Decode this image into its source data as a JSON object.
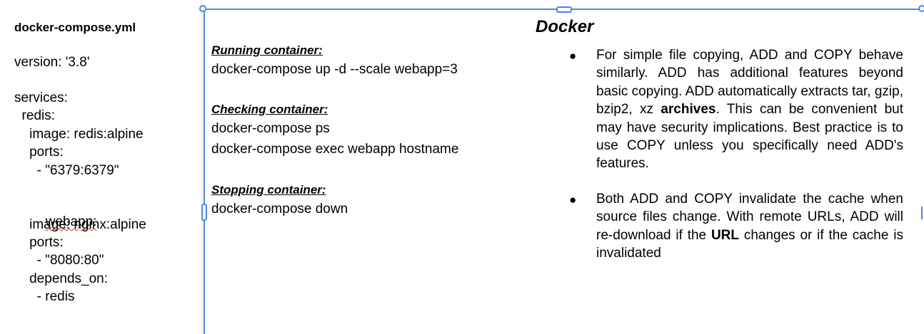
{
  "yaml": {
    "title": "docker-compose.yml",
    "version_line": "version: '3.8'",
    "services_line": "services:",
    "redis_line": "  redis:",
    "redis_image_line": "    image: redis:alpine",
    "redis_ports_line": "    ports:",
    "redis_port_value": "      - \"6379:6379\"",
    "webapp_line": "webapp:",
    "webapp_image_line": "    image: nginx:alpine",
    "webapp_ports_line": "    ports:",
    "webapp_port_value": "      - \"8080:80\"",
    "depends_on_line": "    depends_on:",
    "depends_value": "      - redis"
  },
  "doc": {
    "title": "Docker"
  },
  "commands": {
    "running_heading": "Running container:",
    "running_cmd": "docker-compose up -d --scale webapp=3",
    "checking_heading": "Checking container:",
    "checking_cmd_1": "docker-compose ps",
    "checking_cmd_2": "docker-compose exec webapp hostname",
    "stopping_heading": "Stopping container:",
    "stopping_cmd": "docker-compose down"
  },
  "bullets": {
    "bullet_glyph": "●",
    "b1_part1": "For simple file copying, ADD and COPY behave similarly. ADD has additional features beyond basic copying. ADD automatically extracts tar, gzip, bzip2, xz ",
    "b1_bold": "archives",
    "b1_part2": ". This can be convenient but may have security implications. Best practice is to use COPY unless you specifically need ADD's features.",
    "b2_part1": "Both ADD and COPY invalidate the cache when source files change. With remote URLs, ADD will re-download if the ",
    "b2_bold": "URL",
    "b2_part2": " changes or if the cache is invalidated"
  },
  "colors": {
    "selection_blue": "#4a86e8",
    "spellcheck_red": "#d93025"
  }
}
